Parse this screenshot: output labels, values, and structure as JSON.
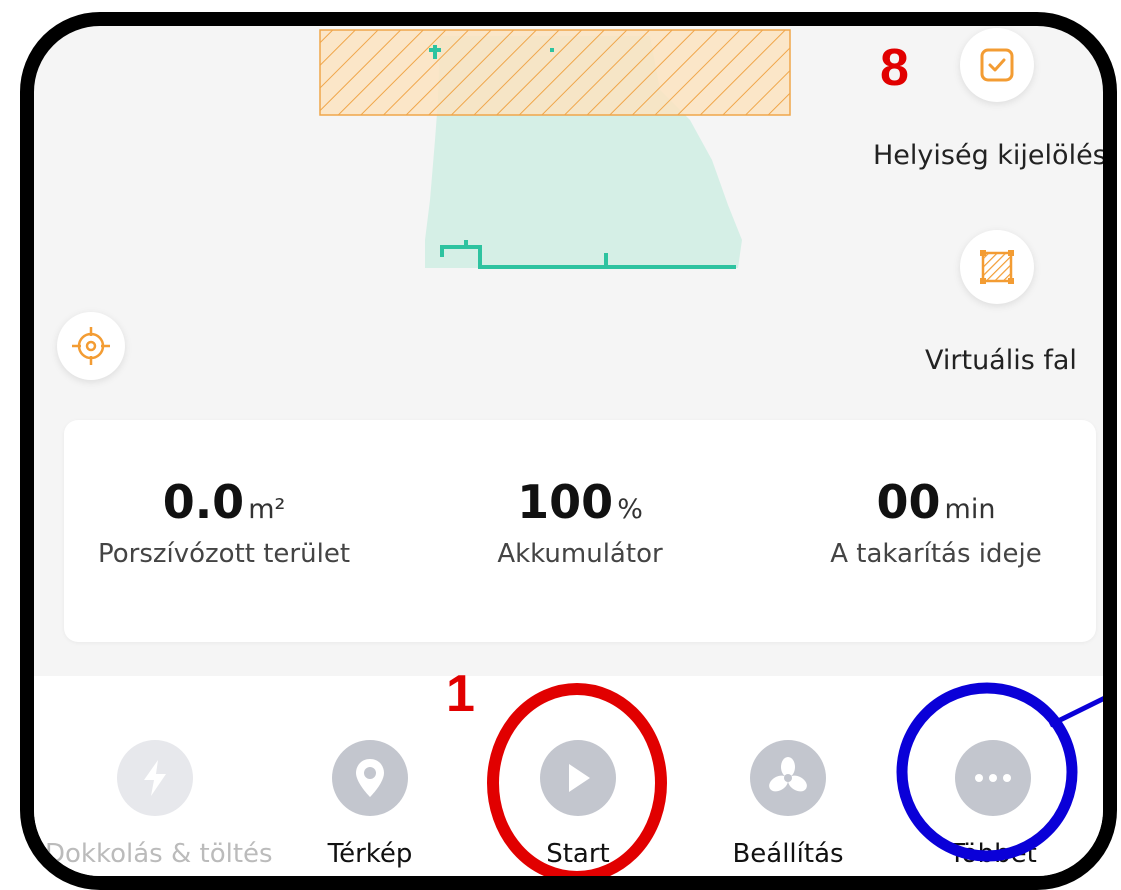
{
  "side_actions": [
    {
      "label": "Helyiség kijelölés",
      "icon": "room-select-icon"
    },
    {
      "label": "Virtuális fal",
      "icon": "virtual-wall-icon"
    }
  ],
  "stats": [
    {
      "value": "0.0",
      "unit": "m²",
      "label": "Porszívózott terület"
    },
    {
      "value": "100",
      "unit": "%",
      "label": "Akkumulátor"
    },
    {
      "value": "00",
      "unit": "min",
      "label": "A takarítás ideje"
    }
  ],
  "nav": [
    {
      "label": "Dokkolás & töltés",
      "icon": "dock-charge-icon"
    },
    {
      "label": "Térkép",
      "icon": "map-pin-icon"
    },
    {
      "label": "Start",
      "icon": "play-icon"
    },
    {
      "label": "Beállítás",
      "icon": "fan-icon"
    },
    {
      "label": "Többet",
      "icon": "more-icon"
    }
  ],
  "annotations": {
    "num_8": "8",
    "num_1": "1"
  },
  "colors": {
    "accent_orange": "#f39c33",
    "map_fill": "#d5efe6",
    "map_wall": "#2ec3a0",
    "annotation_red": "#e10000",
    "annotation_blue": "#0a00d8",
    "nav_icon_gray": "#c3c6ce"
  }
}
